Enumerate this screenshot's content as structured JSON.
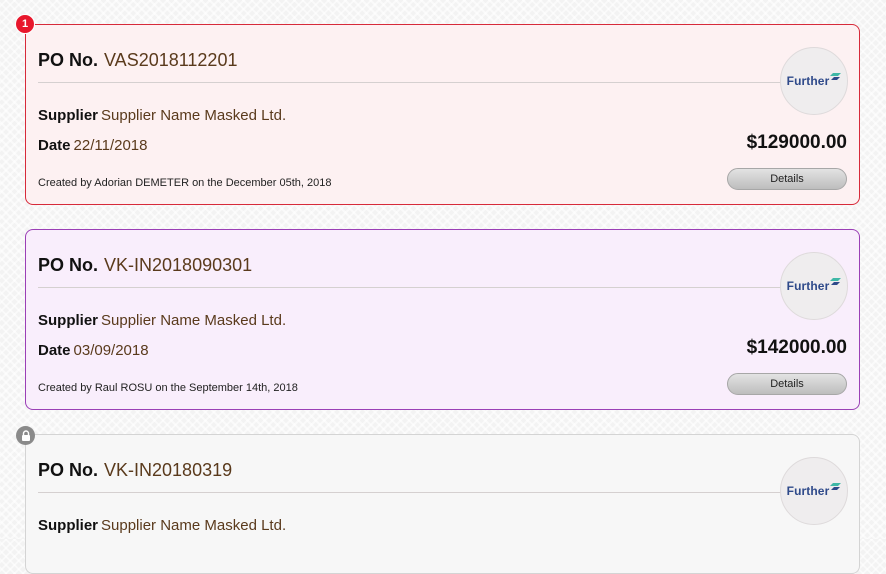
{
  "cards": [
    {
      "badge": "1",
      "po_label": "PO No.",
      "po_number": "VAS2018112201",
      "supplier_label": "Supplier",
      "supplier_name": "Supplier Name Masked Ltd.",
      "date_label": "Date",
      "date": "22/11/2018",
      "amount": "$129000.00",
      "created_by": "Created by Adorian DEMETER on the December 05th, 2018",
      "details_label": "Details",
      "logo_text": "Further",
      "accent_color": "#d72a3a"
    },
    {
      "po_label": "PO No.",
      "po_number": "VK-IN2018090301",
      "supplier_label": "Supplier",
      "supplier_name": "Supplier Name Masked Ltd.",
      "date_label": "Date",
      "date": "03/09/2018",
      "amount": "$142000.00",
      "created_by": "Created by Raul ROSU on the September 14th, 2018",
      "details_label": "Details",
      "logo_text": "Further",
      "accent_color": "#9b3fb6"
    },
    {
      "badge_icon": "lock-icon",
      "po_label": "PO No.",
      "po_number": "VK-IN20180319",
      "supplier_label": "Supplier",
      "supplier_name": "Supplier Name Masked Ltd.",
      "logo_text": "Further",
      "accent_color": "#d4d4d4"
    }
  ]
}
